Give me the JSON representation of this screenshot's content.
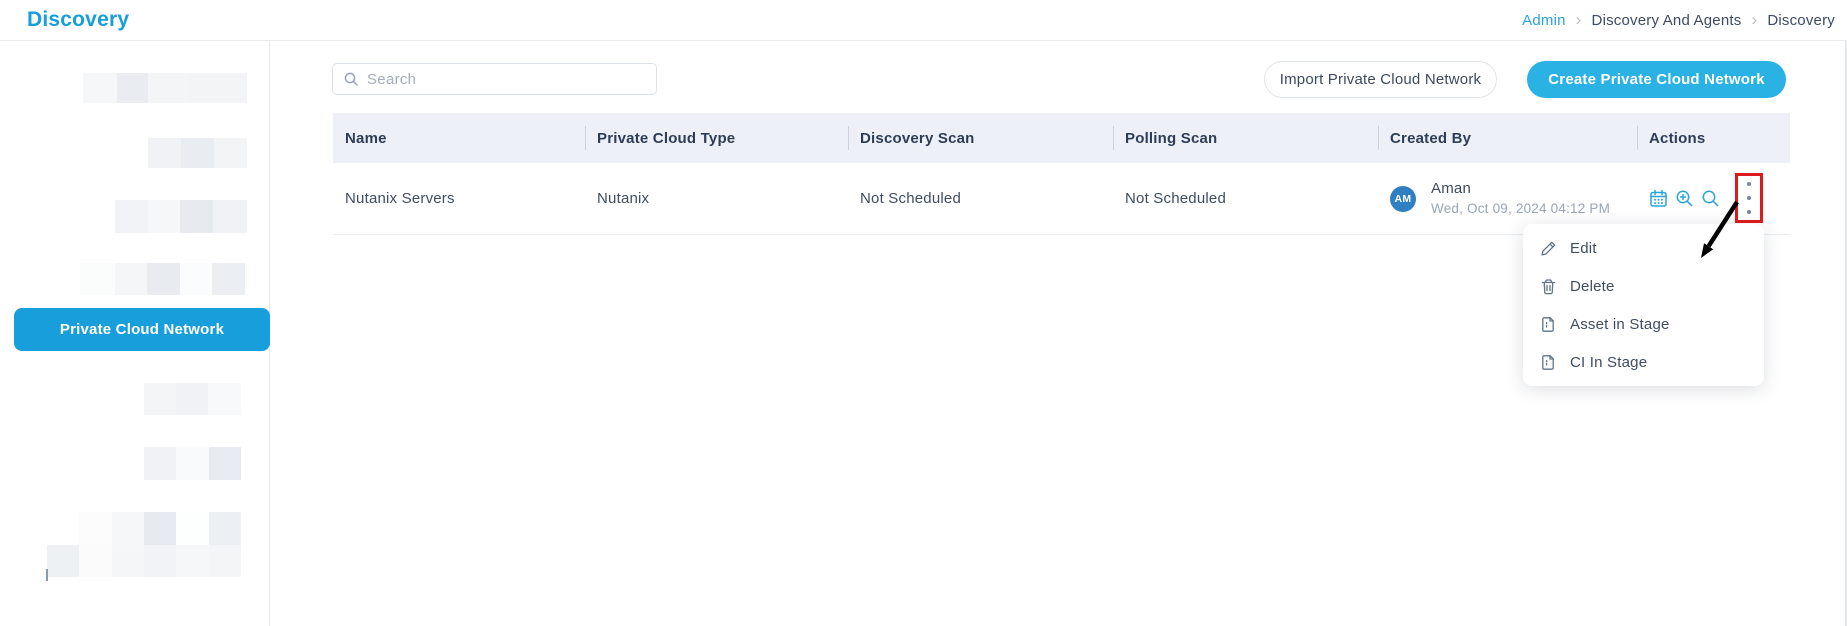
{
  "page": {
    "title": "Discovery"
  },
  "breadcrumb": {
    "separator": "›",
    "items": [
      {
        "label": "Admin"
      },
      {
        "label": "Discovery And Agents"
      },
      {
        "label": "Discovery"
      }
    ]
  },
  "sidebar": {
    "active_item": "Private Cloud Network"
  },
  "toolbar": {
    "search_placeholder": "Search",
    "import_button": "Import Private Cloud Network",
    "create_button": "Create Private Cloud Network"
  },
  "table": {
    "columns": [
      "Name",
      "Private Cloud Type",
      "Discovery Scan",
      "Polling Scan",
      "Created By",
      "Actions"
    ],
    "rows": [
      {
        "name": "Nutanix Servers",
        "private_cloud_type": "Nutanix",
        "discovery_scan": "Not Scheduled",
        "polling_scan": "Not Scheduled",
        "created_by": {
          "avatar_initials": "AM",
          "name": "Aman",
          "date": "Wed, Oct 09, 2024 04:12 PM"
        },
        "action_icons": [
          "calendar-icon",
          "zoom-in-icon",
          "search-icon",
          "kebab-menu-icon"
        ]
      }
    ]
  },
  "context_menu": {
    "items": [
      {
        "icon": "edit-icon",
        "label": "Edit"
      },
      {
        "icon": "delete-icon",
        "label": "Delete"
      },
      {
        "icon": "asset-in-stage-icon",
        "label": "Asset in Stage"
      },
      {
        "icon": "ci-in-stage-icon",
        "label": "CI In Stage"
      }
    ]
  },
  "colors": {
    "accent_blue": "#189fdb",
    "create_button_blue": "#29b2e3",
    "action_icon_blue": "#2aa5db",
    "avatar_blue": "#2f80c2",
    "annotation_red": "#e01a1a",
    "annotation_arrow": "#000000"
  }
}
